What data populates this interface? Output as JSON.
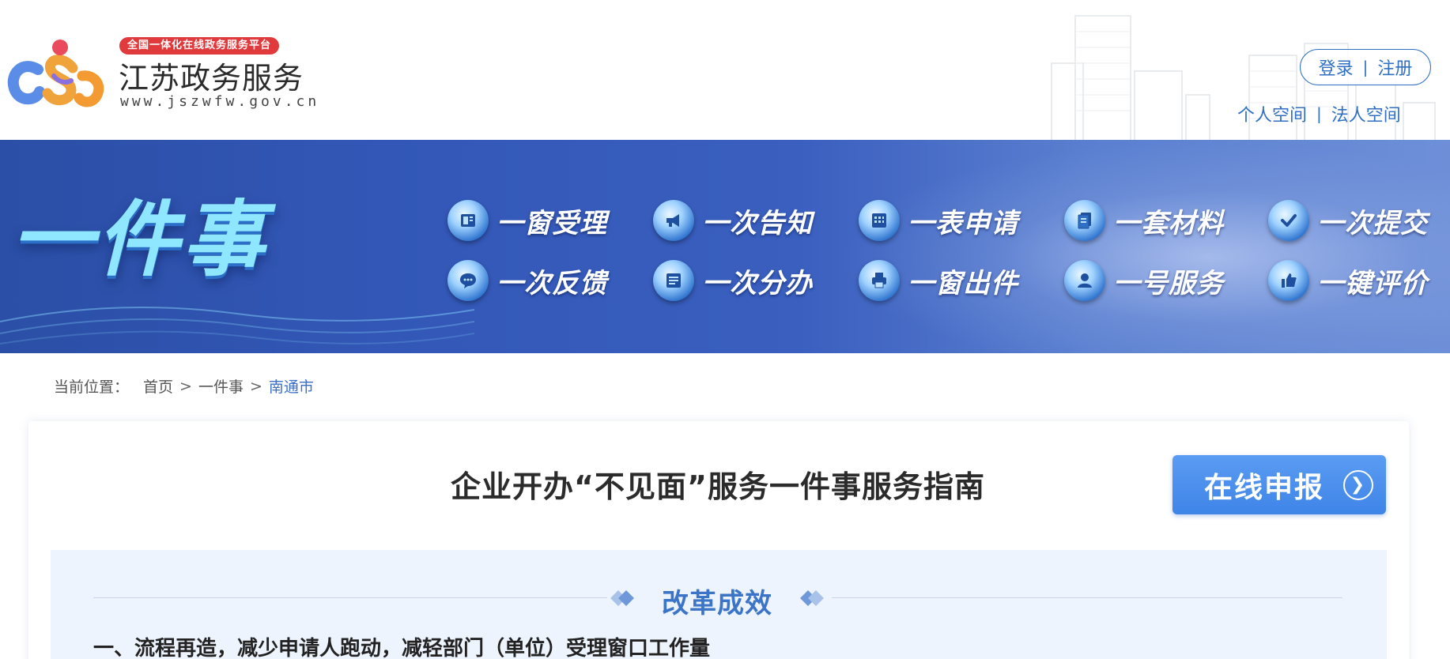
{
  "header": {
    "logo_tag": "全国一体化在线政务服务平台",
    "logo_name": "江苏政务服务",
    "logo_url": "www.jszwfw.gov.cn",
    "login": "登录",
    "register": "注册",
    "separator": "|",
    "personal_space": "个人空间",
    "legal_space": "法人空间"
  },
  "banner": {
    "title": "一件事",
    "features": [
      {
        "label": "一窗受理",
        "icon": "window-icon"
      },
      {
        "label": "一次告知",
        "icon": "megaphone-icon"
      },
      {
        "label": "一表申请",
        "icon": "table-icon"
      },
      {
        "label": "一套材料",
        "icon": "documents-icon"
      },
      {
        "label": "一次提交",
        "icon": "check-icon"
      },
      {
        "label": "一次反馈",
        "icon": "chat-icon"
      },
      {
        "label": "一次分办",
        "icon": "list-icon"
      },
      {
        "label": "一窗出件",
        "icon": "printer-icon"
      },
      {
        "label": "一号服务",
        "icon": "person-icon"
      },
      {
        "label": "一键评价",
        "icon": "thumbs-up-icon"
      }
    ]
  },
  "breadcrumb": {
    "label": "当前位置：",
    "items": [
      "首页",
      "一件事",
      "南通市"
    ],
    "separator": ">"
  },
  "guide": {
    "title": "企业开办“不见面”服务一件事服务指南",
    "apply_label": "在线申报",
    "section_title": "改革成效",
    "section_item_1": "一、流程再造，减少申请人跑动，减轻部门（单位）受理窗口工作量"
  },
  "colors": {
    "brand_blue": "#2f6fc4",
    "banner_blue": "#3358b8",
    "apply_button": "#4a8eee",
    "section_bg": "#eef4fd"
  }
}
